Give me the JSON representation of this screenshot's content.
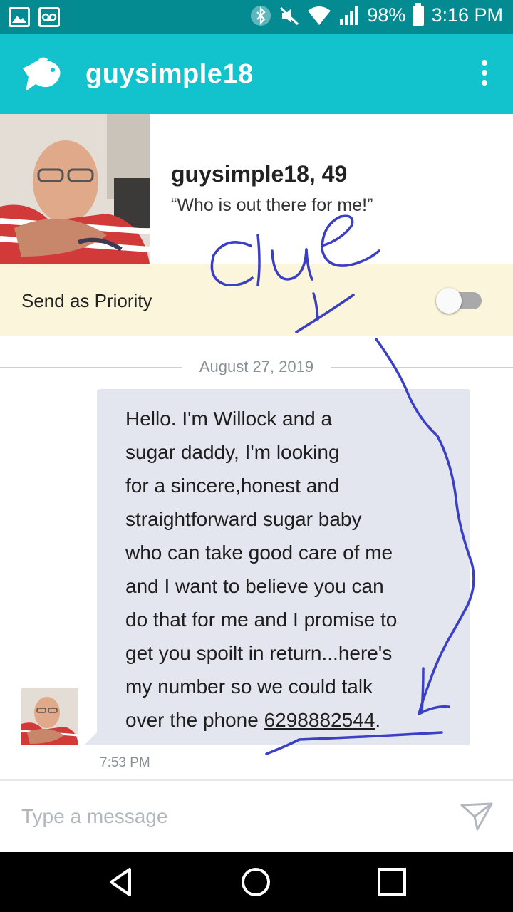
{
  "status_bar": {
    "battery": "98%",
    "time": "3:16 PM"
  },
  "app_bar": {
    "title": "guysimple18"
  },
  "profile": {
    "name_age": "guysimple18, 49",
    "tagline": "“Who is out there for me!”"
  },
  "priority": {
    "label": "Send as Priority",
    "enabled": false
  },
  "conversation": {
    "date": "August 27, 2019",
    "messages": [
      {
        "text": "Hello. I'm Willock and a\nsugar daddy, I'm looking\nfor a sincere,honest and\nstraightforward sugar baby\nwho can take good care of me\nand I want to believe you can\ndo that for me and I promise to\nget you spoilt in return...here's\nmy number so we could talk\nover the phone ",
        "phone": "6298882544",
        "suffix": ".",
        "time": "7:53 PM"
      }
    ]
  },
  "composer": {
    "placeholder": "Type a message"
  },
  "annotation": {
    "text": "clue 1",
    "color": "#3a3fc4"
  },
  "colors": {
    "status_bar": "#048a91",
    "app_bar": "#12c2cd",
    "priority_bg": "#fbf6db",
    "bubble": "#e3e6ee"
  },
  "icons": [
    "gallery-icon",
    "voicemail-icon",
    "bluetooth-icon",
    "mute-icon",
    "wifi-icon",
    "signal-icon",
    "battery-icon",
    "fish-logo-icon",
    "more-vert-icon",
    "send-icon",
    "back-nav-icon",
    "home-nav-icon",
    "recents-nav-icon"
  ]
}
